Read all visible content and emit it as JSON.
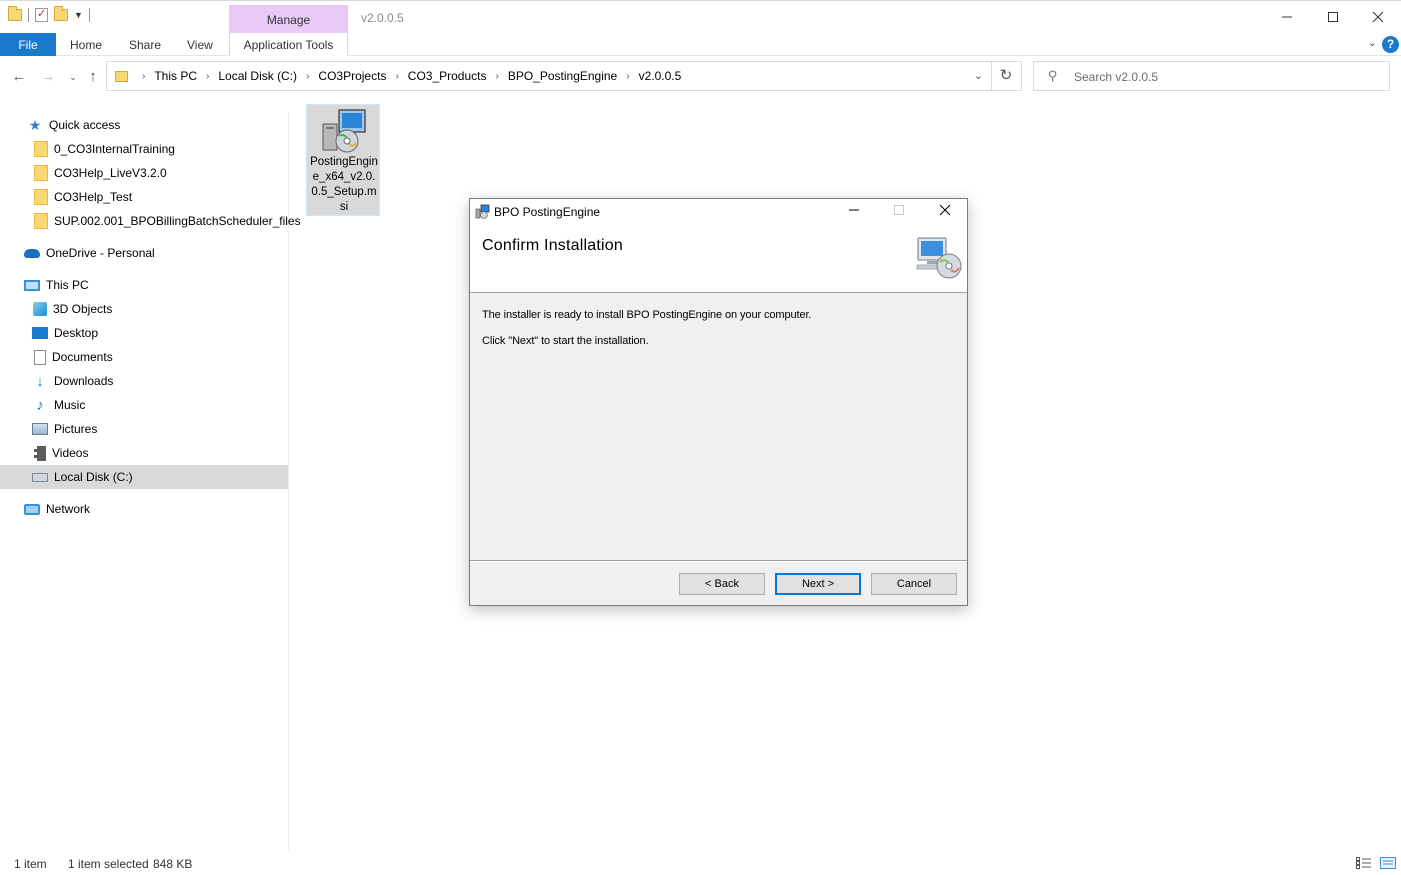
{
  "window": {
    "title": "v2.0.0.5",
    "context_group": "Manage"
  },
  "ribbon": {
    "tabs": [
      "File",
      "Home",
      "Share",
      "View"
    ],
    "context_tab": "Application Tools"
  },
  "address": {
    "crumbs": [
      "This PC",
      "Local Disk (C:)",
      "CO3Projects",
      "CO3_Products",
      "BPO_PostingEngine",
      "v2.0.0.5"
    ]
  },
  "search": {
    "placeholder": "Search v2.0.0.5"
  },
  "sidebar": {
    "items": [
      {
        "label": "Quick access",
        "icon": "star-icon"
      },
      {
        "label": "0_CO3InternalTraining",
        "icon": "folder-icon"
      },
      {
        "label": "CO3Help_LiveV3.2.0",
        "icon": "folder-icon"
      },
      {
        "label": "CO3Help_Test",
        "icon": "folder-icon"
      },
      {
        "label": "SUP.002.001_BPOBillingBatchScheduler_files",
        "icon": "folder-icon"
      },
      {
        "label": "OneDrive - Personal",
        "icon": "cloud-icon"
      },
      {
        "label": "This PC",
        "icon": "computer-icon"
      },
      {
        "label": "3D Objects",
        "icon": "cube-icon"
      },
      {
        "label": "Desktop",
        "icon": "desktop-icon"
      },
      {
        "label": "Documents",
        "icon": "documents-icon"
      },
      {
        "label": "Downloads",
        "icon": "download-arrow-icon"
      },
      {
        "label": "Music",
        "icon": "music-note-icon"
      },
      {
        "label": "Pictures",
        "icon": "pictures-icon"
      },
      {
        "label": "Videos",
        "icon": "film-icon"
      },
      {
        "label": "Local Disk (C:)",
        "icon": "drive-icon"
      },
      {
        "label": "Network",
        "icon": "network-icon"
      }
    ]
  },
  "files": [
    {
      "name": "PostingEngine_x64_v2.0.0.5_Setup.msi",
      "icon": "msi-installer-icon"
    }
  ],
  "dialog": {
    "title": "BPO PostingEngine",
    "heading": "Confirm Installation",
    "line1": "The installer is ready to install BPO PostingEngine on your computer.",
    "line2": "Click \"Next\" to start the installation.",
    "back_label": "< Back",
    "next_label": "Next >",
    "cancel_label": "Cancel"
  },
  "status": {
    "count": "1 item",
    "selection": "1 item selected",
    "size": "848 KB"
  },
  "colors": {
    "accent": "#1979ca",
    "context_tab": "#e9c9f5",
    "selection": "#d9d9d9",
    "default_button_border": "#0078d7"
  }
}
